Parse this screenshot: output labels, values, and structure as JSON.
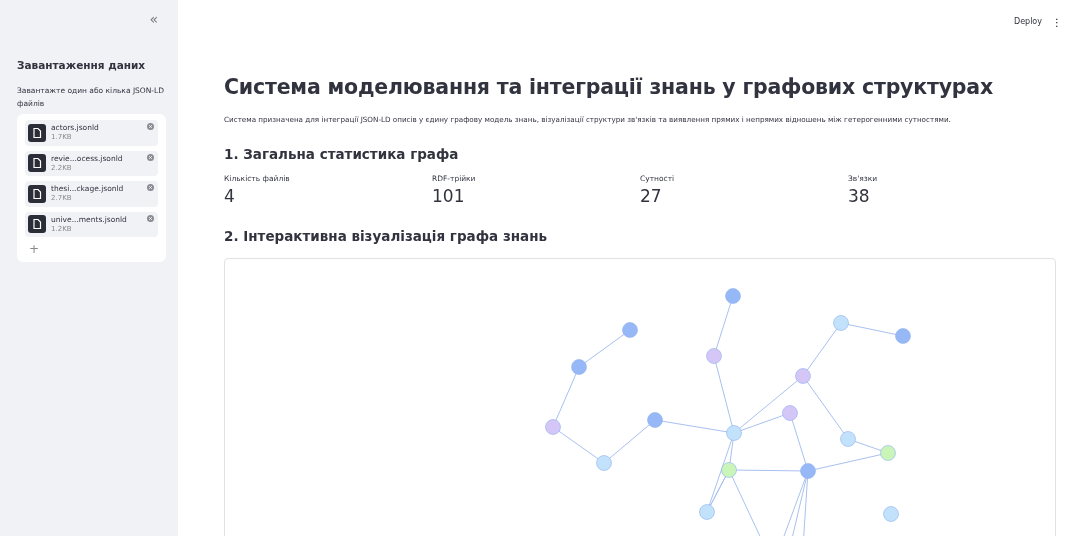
{
  "sidebar": {
    "collapse_icon": "«",
    "title": "Завантаження даних",
    "uploader_label": "Завантажте один або кілька JSON-LD файлів",
    "files": [
      {
        "name": "actors.jsonld",
        "size": "1.7KB"
      },
      {
        "name": "revie...ocess.jsonld",
        "size": "2.2KB"
      },
      {
        "name": "thesi...ckage.jsonld",
        "size": "2.7KB"
      },
      {
        "name": "unive...ments.jsonld",
        "size": "1.2KB"
      }
    ],
    "add_icon": "+"
  },
  "header": {
    "deploy": "Deploy",
    "menu_icon": "⋮"
  },
  "title": "Система моделювання та інтеграції знань у графових структурах",
  "description": "Система призначена для інтеграції JSON-LD описів у єдину графову модель знань, візуалізації структури зв'язків та виявлення прямих і непрямих відношень між гетерогенними сутностями.",
  "stats": {
    "heading": "1. Загальна статистика графа",
    "metrics": [
      {
        "label": "Кількість файлів",
        "value": "4"
      },
      {
        "label": "RDF-трійки",
        "value": "101"
      },
      {
        "label": "Сутності",
        "value": "27"
      },
      {
        "label": "Зв'язки",
        "value": "38"
      }
    ]
  },
  "graph": {
    "heading": "2. Інтерактивна візуалізація графа знань"
  }
}
